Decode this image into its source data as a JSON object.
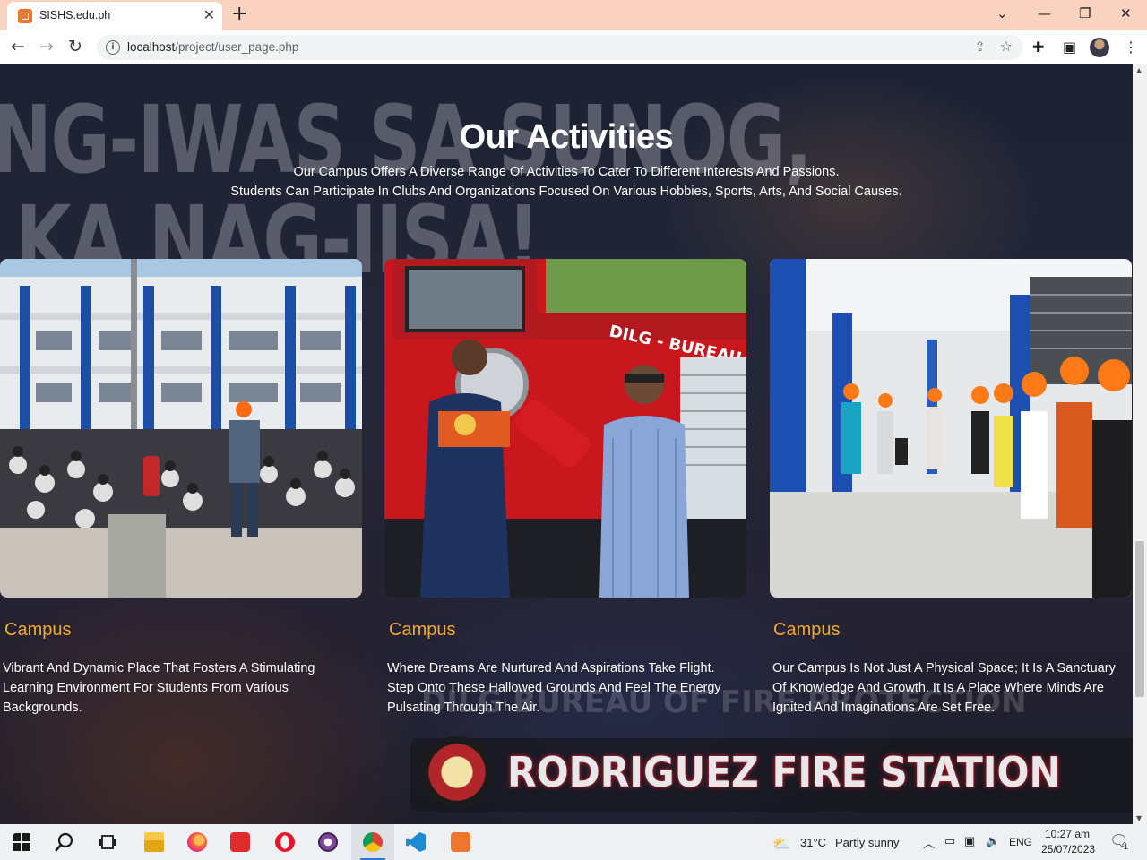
{
  "browser": {
    "tab_title": "SISHS.edu.ph",
    "url_host": "localhost",
    "url_path": "/project/user_page.php"
  },
  "page": {
    "background_slogan": "NG-IWAS SA SUNOG,\n KA NAG-IISA!",
    "background_watermark": "DILG  BUREAU OF FIRE PROTECTION",
    "station_name": "RODRIGUEZ FIRE STATION",
    "station_seal_text": "RODRIGUEZ FIRE STATION",
    "section_title": "Our Activities",
    "section_sub_line1": "Our Campus Offers A Diverse Range Of Activities To Cater To Different Interests And Passions.",
    "section_sub_line2": "Students Can Participate In Clubs And Organizations Focused On Various Hobbies, Sports, Arts, And Social Causes.",
    "accent_color": "#f2a82d",
    "cards": [
      {
        "title": "Campus",
        "text": "Vibrant And Dynamic Place That Fosters A Stimulating Learning Environment For Students From Various Backgrounds.",
        "image": "students-seated-in-courtyard-photo"
      },
      {
        "title": "Campus",
        "text": "Where Dreams Are Nurtured And Aspirations Take Flight. Step Onto These Hallowed Grounds And Feel The Energy Pulsating Through The Air.",
        "image": "fire-extinguisher-handover-photo",
        "image_text": "DILG - BUREAU O"
      },
      {
        "title": "Campus",
        "text": "Our Campus Is Not Just A Physical Space; It Is A Sanctuary Of Knowledge And Growth. It Is A Place Where Minds Are Ignited And Imaginations Are Set Free.",
        "image": "students-with-hardhats-corridor-photo"
      }
    ]
  },
  "taskbar": {
    "weather_temp": "31°C",
    "weather_desc": "Partly sunny",
    "language": "ENG",
    "time": "10:27 am",
    "date": "25/07/2023",
    "notification_count": "1"
  }
}
